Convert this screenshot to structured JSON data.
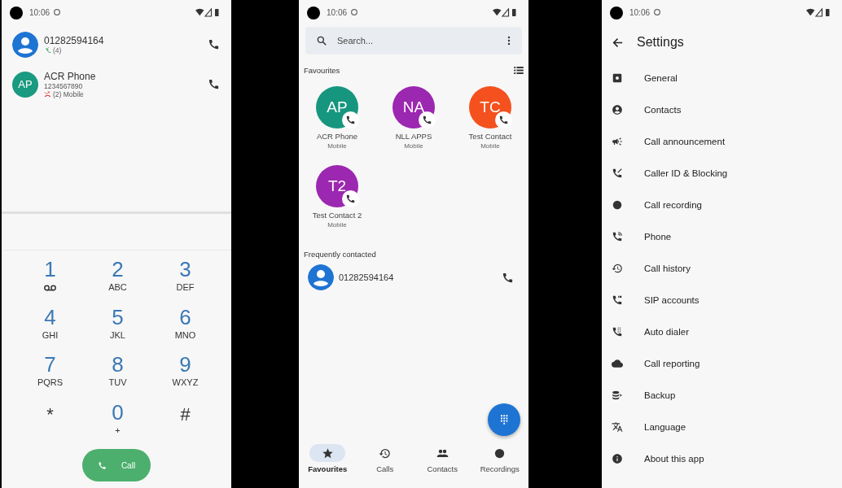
{
  "dialer_screen": {
    "status_bar": {
      "time": "10:06"
    },
    "call_log": [
      {
        "avatar": {
          "kind": "silhouette"
        },
        "title": "01282594164",
        "kind": "incoming",
        "detail": "(4)"
      },
      {
        "avatar": {
          "kind": "initials",
          "initials": "AP",
          "color": "#1a9a80"
        },
        "title": "ACR Phone",
        "number": "1234567890",
        "kind": "missed",
        "detail": "(2) Mobile"
      }
    ],
    "keypad": [
      {
        "digit": "1",
        "kind": "voicemail"
      },
      {
        "digit": "2",
        "kind": "letters",
        "letters": "ABC"
      },
      {
        "digit": "3",
        "kind": "letters",
        "letters": "DEF"
      },
      {
        "digit": "4",
        "kind": "letters",
        "letters": "GHI"
      },
      {
        "digit": "5",
        "kind": "letters",
        "letters": "JKL"
      },
      {
        "digit": "6",
        "kind": "letters",
        "letters": "MNO"
      },
      {
        "digit": "7",
        "kind": "letters",
        "letters": "PQRS"
      },
      {
        "digit": "8",
        "kind": "letters",
        "letters": "TUV"
      },
      {
        "digit": "9",
        "kind": "letters",
        "letters": "WXYZ"
      },
      {
        "digit": "*",
        "kind": "symbol"
      },
      {
        "digit": "0",
        "kind": "letters",
        "letters": "+"
      },
      {
        "digit": "#",
        "kind": "symbol"
      }
    ],
    "call_button": {
      "label": "Call"
    }
  },
  "favourites_screen": {
    "status_bar": {
      "time": "10:06"
    },
    "search": {
      "placeholder": "Search..."
    },
    "favourites": {
      "title": "Favourites",
      "contacts": [
        {
          "initials": "AP",
          "color": "#17967f",
          "name": "ACR Phone",
          "label": "Mobile"
        },
        {
          "initials": "NA",
          "color": "#9c27b0",
          "name": "NLL APPS",
          "label": "Mobile"
        },
        {
          "initials": "TC",
          "color": "#f4511e",
          "name": "Test Contact",
          "label": "Mobile"
        },
        {
          "initials": "T2",
          "color": "#9c27b0",
          "name": "Test Contact 2",
          "label": "Mobile"
        }
      ]
    },
    "frequently_contacted": {
      "title": "Frequently contacted",
      "contacts": [
        {
          "name": "01282594164"
        }
      ]
    },
    "nav": [
      {
        "kind": "favourites",
        "label": "Favourites",
        "selected": true
      },
      {
        "kind": "calls",
        "label": "Calls",
        "selected": false
      },
      {
        "kind": "contacts",
        "label": "Contacts",
        "selected": false
      },
      {
        "kind": "recordings",
        "label": "Recordings",
        "selected": false
      }
    ]
  },
  "settings_screen": {
    "status_bar": {
      "time": "10:06"
    },
    "title": "Settings",
    "items": [
      {
        "kind": "general",
        "label": "General"
      },
      {
        "kind": "contacts",
        "label": "Contacts"
      },
      {
        "kind": "announcement",
        "label": "Call announcement"
      },
      {
        "kind": "blocking",
        "label": "Caller ID & Blocking"
      },
      {
        "kind": "recording",
        "label": "Call recording"
      },
      {
        "kind": "phone",
        "label": "Phone"
      },
      {
        "kind": "history",
        "label": "Call history"
      },
      {
        "kind": "sip",
        "label": "SIP accounts"
      },
      {
        "kind": "autodialer",
        "label": "Auto dialer"
      },
      {
        "kind": "reporting",
        "label": "Call reporting"
      },
      {
        "kind": "backup",
        "label": "Backup"
      },
      {
        "kind": "language",
        "label": "Language"
      },
      {
        "kind": "about",
        "label": "About this app"
      }
    ]
  }
}
